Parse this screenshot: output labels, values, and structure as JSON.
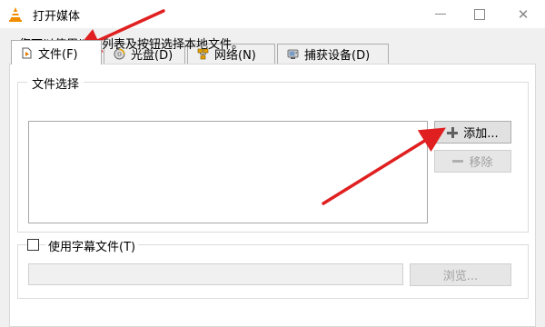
{
  "window": {
    "title": "打开媒体"
  },
  "tabs": [
    {
      "label": "文件(F)",
      "icon": "file-icon",
      "active": true
    },
    {
      "label": "光盘(D)",
      "icon": "disc-icon",
      "active": false
    },
    {
      "label": "网络(N)",
      "icon": "network-icon",
      "active": false
    },
    {
      "label": "捕获设备(D)",
      "icon": "capture-device-icon",
      "active": false
    }
  ],
  "file_section": {
    "legend": "文件选择",
    "description": "您可以使用以下列表及按钮选择本地文件。",
    "add_label": "添加...",
    "remove_label": "移除"
  },
  "subtitle_section": {
    "checkbox_label": "使用字幕文件(T)",
    "checked": false,
    "browse_label": "浏览..."
  },
  "annotations": {
    "arrow_color": "#e02020"
  },
  "colors": {
    "vlc_orange": "#f28c00"
  }
}
